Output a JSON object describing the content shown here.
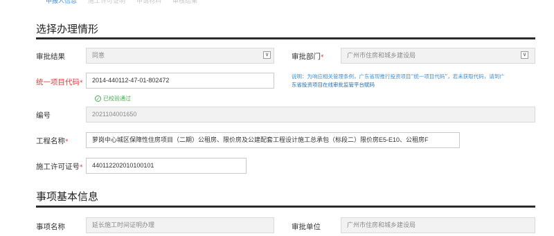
{
  "steps": [
    {
      "label": "申报人信息",
      "active": true
    },
    {
      "label": "施工许可证明",
      "active": false
    },
    {
      "label": "申请材料",
      "active": false
    },
    {
      "label": "审核结果",
      "active": false
    }
  ],
  "section1": {
    "title": "选择办理情形",
    "result_label": "审批结果",
    "result_value": "同意",
    "dept_label": "审批部门",
    "dept_value": "广州市住房和城乡建设局",
    "project_code_label": "统一项目代码",
    "project_code_value": "2014-440112-47-01-802472",
    "hint_line1": "说明：为响应相关管理条例，广东省现推行投资项目“统一项目代码”，若未获取代码，请到广",
    "hint_line2": "东省投资项目在线审批监管平台赋码",
    "verified_text": "已校验通过",
    "number_label": "编号",
    "number_value": "2021104001650",
    "project_name_label": "工程名称",
    "project_name_value": "萝岗中心城区保障性住房项目（二期）公租房、限价房及公建配套工程设计施工总承包（标段二）限价房E5-E10、公租房F",
    "permit_label": "施工许可证号",
    "permit_value": "440112202010100101"
  },
  "section2": {
    "title": "事项基本信息",
    "item_name_label": "事项名称",
    "item_name_value": "延长施工时间证明办理",
    "approval_unit_label": "审批单位",
    "approval_unit_value": "广州市住房和城乡建设局"
  },
  "icons": {
    "dropdown": "chevron-down-icon",
    "check": "check-circle-icon"
  },
  "colors": {
    "required": "#e23b3b",
    "hint": "#3a8fd8",
    "verified": "#3fae49",
    "active_step": "#3d8bd6"
  }
}
